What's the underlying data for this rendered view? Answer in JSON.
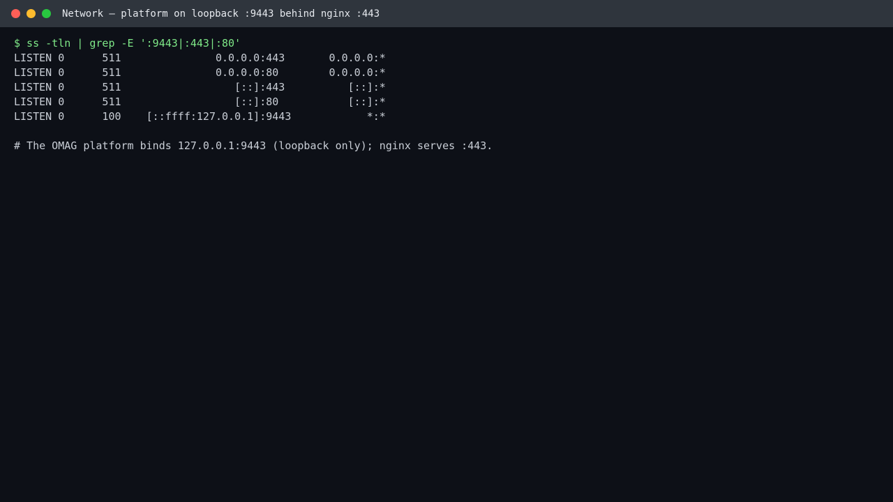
{
  "window": {
    "title": "Network — platform on loopback :9443 behind nginx :443"
  },
  "terminal": {
    "command": "$ ss -tln | grep -E ':9443|:443|:80'",
    "output_lines": [
      "LISTEN 0      511               0.0.0.0:443       0.0.0.0:*",
      "LISTEN 0      511               0.0.0.0:80        0.0.0.0:*",
      "LISTEN 0      511                  [::]:443          [::]:*",
      "LISTEN 0      511                  [::]:80           [::]:*",
      "LISTEN 0      100    [::ffff:127.0.0.1]:9443            *:*"
    ],
    "comment": "# The OMAG platform binds 127.0.0.1:9443 (loopback only); nginx serves :443."
  },
  "colors": {
    "titlebar_bg": "#2f353d",
    "terminal_bg": "#0d1017",
    "prompt": "#7ee787",
    "text": "#c9ced6"
  }
}
